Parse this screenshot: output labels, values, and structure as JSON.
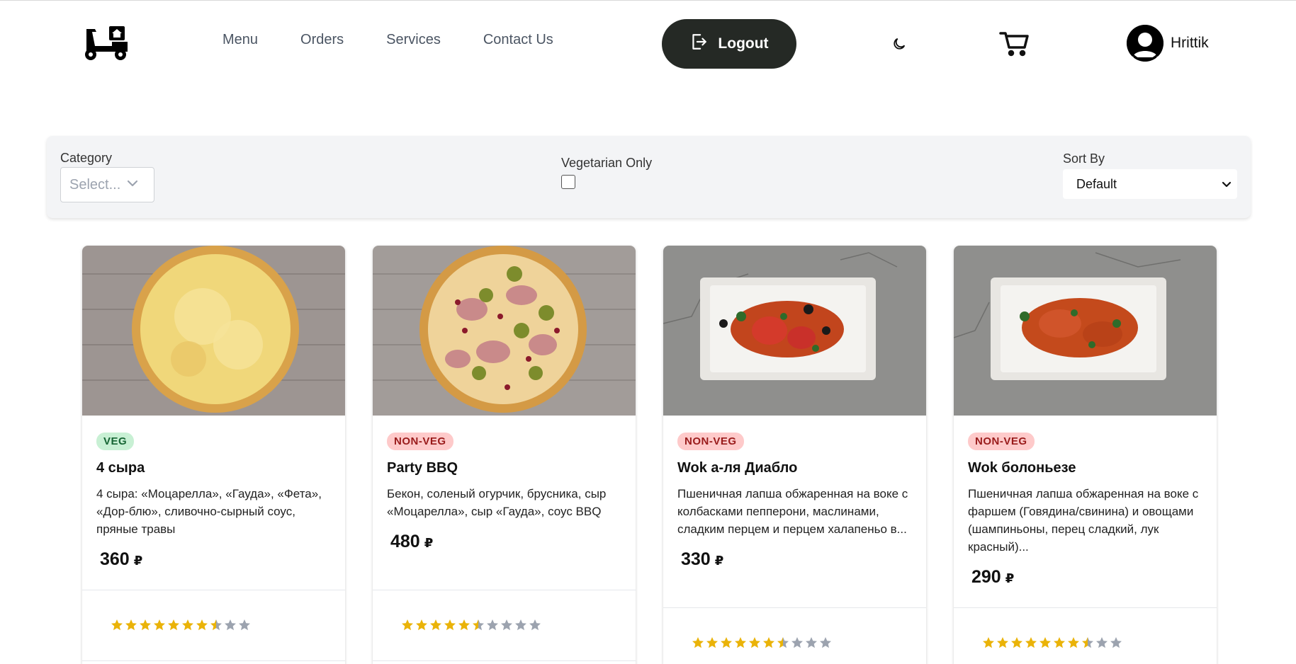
{
  "nav": {
    "menu": "Menu",
    "orders": "Orders",
    "services": "Services",
    "contact": "Contact Us",
    "logout": "Logout",
    "username": "Hrittik"
  },
  "filters": {
    "category_label": "Category",
    "category_placeholder": "Select...",
    "veg_label": "Vegetarian Only",
    "veg_checked": false,
    "sort_label": "Sort By",
    "sort_value": "Default"
  },
  "currency": "₽",
  "colors": {
    "star_filled": "#eab308",
    "star_empty": "#9ca3af",
    "logout_bg": "#252925"
  },
  "items": [
    {
      "badge": "VEG",
      "title": "4 сыра",
      "description": "4 сыра: «Моцарелла», «Гауда», «Фета», «Дор-блю», сливочно-сырный соус, пряные травы",
      "price": "360",
      "rating": 7.5
    },
    {
      "badge": "NON-VEG",
      "title": "Party BBQ",
      "description": "Бекон, соленый огурчик, брусника, сыр «Моцарелла», сыр «Гауда», соус BBQ",
      "price": "480",
      "rating": 5.5
    },
    {
      "badge": "NON-VEG",
      "title": "Wok а-ля Диабло",
      "description": "Пшеничная лапша обжаренная на воке с колбасками пепперони, маслинами, сладким перцем и перцем халапеньо в...",
      "price": "330",
      "rating": 6.5
    },
    {
      "badge": "NON-VEG",
      "title": "Wok болоньезе",
      "description": "Пшеничная лапша обжаренная на воке с фаршем (Говядина/свинина) и овощами (шампиньоны, перец сладкий, лук красный)...",
      "price": "290",
      "rating": 7.5
    }
  ]
}
